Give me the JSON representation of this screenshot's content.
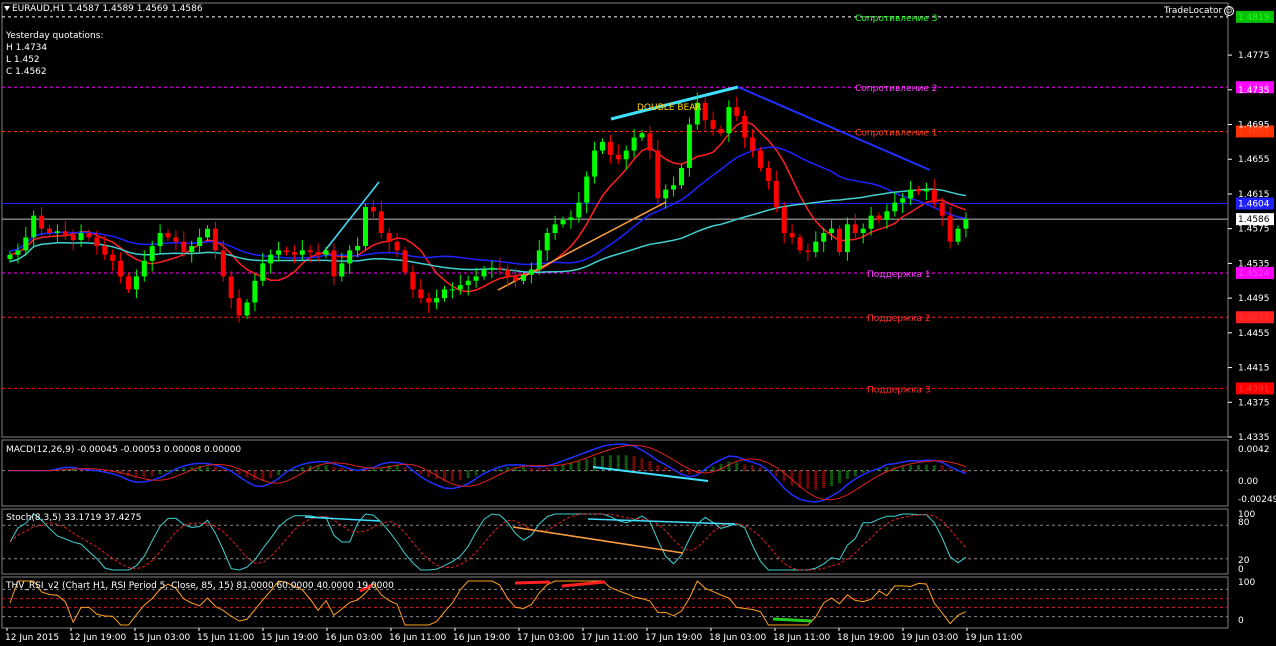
{
  "header": {
    "symbol_line": "EURAUD,H1  1.4587 1.4589 1.4569 1.4586",
    "tradelocator": "TradeLocator",
    "yesterday": {
      "title": "Yesterday quotations:",
      "high": "H 1.4734",
      "low": "L 1.452",
      "close": "C 1.4562"
    }
  },
  "colors": {
    "background": "#000000",
    "bull": "#00ff00",
    "bear": "#ff0000",
    "ma_red": "#ff2020",
    "ma_blue": "#1e22ff",
    "ma_cyan": "#40d0d0",
    "grid": "#ffffff"
  },
  "chart_data": [
    {
      "type": "candlestick",
      "panel": "price",
      "ylim": [
        1.4335,
        1.4835
      ],
      "y_ticks": [
        "1.4775",
        "1.4735",
        "1.4695",
        "1.4655",
        "1.4615",
        "1.4575",
        "1.4535",
        "1.4495",
        "1.4455",
        "1.4415",
        "1.4375",
        "1.4335"
      ],
      "x_tick_labels": [
        "12 Jun 2015",
        "12 Jun 19:00",
        "15 Jun 03:00",
        "15 Jun 11:00",
        "15 Jun 19:00",
        "16 Jun 03:00",
        "16 Jun 11:00",
        "16 Jun 19:00",
        "17 Jun 03:00",
        "17 Jun 11:00",
        "17 Jun 19:00",
        "18 Jun 03:00",
        "18 Jun 11:00",
        "18 Jun 19:00",
        "19 Jun 03:00",
        "19 Jun 11:00"
      ],
      "close": [
        1.4545,
        1.455,
        1.4565,
        1.459,
        1.4575,
        1.457,
        1.4572,
        1.4568,
        1.4562,
        1.457,
        1.4565,
        1.4555,
        1.4545,
        1.4538,
        1.452,
        1.4505,
        1.452,
        1.4538,
        1.4555,
        1.457,
        1.4565,
        1.456,
        1.4548,
        1.4555,
        1.4565,
        1.4575,
        1.455,
        1.452,
        1.4495,
        1.4475,
        1.449,
        1.4515,
        1.4535,
        1.4545,
        1.455,
        1.4548,
        1.4545,
        1.455,
        1.4548,
        1.4545,
        1.455,
        1.452,
        1.4535,
        1.455,
        1.4555,
        1.46,
        1.4595,
        1.457,
        1.456,
        1.455,
        1.4525,
        1.4505,
        1.4495,
        1.449,
        1.4495,
        1.4505,
        1.4505,
        1.451,
        1.4515,
        1.452,
        1.4528,
        1.453,
        1.4528,
        1.452,
        1.4515,
        1.4522,
        1.4528,
        1.455,
        1.457,
        1.458,
        1.4585,
        1.4588,
        1.4605,
        1.4635,
        1.4665,
        1.4675,
        1.466,
        1.4655,
        1.4665,
        1.468,
        1.4685,
        1.4665,
        1.461,
        1.462,
        1.4625,
        1.4645,
        1.4695,
        1.472,
        1.47,
        1.469,
        1.4685,
        1.4715,
        1.4705,
        1.468,
        1.4665,
        1.4645,
        1.463,
        1.46,
        1.457,
        1.4565,
        1.455,
        1.4548,
        1.456,
        1.457,
        1.4575,
        1.4548,
        1.458,
        1.457,
        1.4575,
        1.459,
        1.4585,
        1.4595,
        1.4605,
        1.461,
        1.462,
        1.4618,
        1.462,
        1.4605,
        1.459,
        1.456,
        1.4575,
        1.4586
      ]
    },
    {
      "type": "line",
      "panel": "macd",
      "name": "MACD(12,26,9) -0.00045 -0.00053 0.00008 0.00000",
      "y_ticks": [
        "0.0042",
        "0.00",
        "-0.00249"
      ],
      "ylim": [
        -0.00249,
        0.0042
      ]
    },
    {
      "type": "line",
      "panel": "stoch",
      "name": "Stoch(8,3,5) 33.1719 37.4275",
      "y_ticks": [
        "100",
        "80",
        "20",
        "0"
      ],
      "ylim": [
        0,
        100
      ]
    },
    {
      "type": "line",
      "panel": "rsi",
      "name": "THV_RSI_v2 (Chart H1, RSI Period 5, Close, 85, 15) 81.0000 60.0000 40.0000 19.0000",
      "y_ticks": [
        "100",
        "0"
      ],
      "ylim": [
        0,
        100
      ]
    }
  ],
  "levels": [
    {
      "label": "Сопротивление 3",
      "price": "1.4819",
      "box_color": "#00c000",
      "text_color": "#22ff22",
      "line_color": "#ffffff",
      "dash": true
    },
    {
      "label": "Сопротивление 2",
      "price": "1.4738",
      "box_color": "#ff00ff",
      "text_color": "#ff40ff",
      "line_color": "#ff00ff",
      "dash": true
    },
    {
      "label": "Сопротивление 1",
      "price": "1.4687",
      "box_color": "#ff3300",
      "text_color": "#ff4422",
      "line_color": "#ff3300",
      "dash": true
    },
    {
      "label": "",
      "price": "1.4604",
      "box_color": "#1e22ff",
      "text_color": "#ffffff",
      "line_color": "#1e22ff",
      "dash": false
    },
    {
      "label": "",
      "price": "1.4586",
      "box_color": "#ffffff",
      "text_color": "#000000",
      "line_color": "#bbbbbb",
      "dash": false
    },
    {
      "label": "Поддержка 1",
      "price": "1.4524",
      "box_color": "#ff00ff",
      "text_color": "#ff40ff",
      "line_color": "#ff00ff",
      "dash": true
    },
    {
      "label": "Поддержка 2",
      "price": "1.4473",
      "box_color": "#ff2020",
      "text_color": "#ff3030",
      "line_color": "#ff2020",
      "dash": true
    },
    {
      "label": "Поддержка 3",
      "price": "1.4391",
      "box_color": "#ff0000",
      "text_color": "#ff3030",
      "line_color": "#ff0000",
      "dash": true
    }
  ],
  "annotations": {
    "double_bear": "DOUBLE BEAR"
  }
}
